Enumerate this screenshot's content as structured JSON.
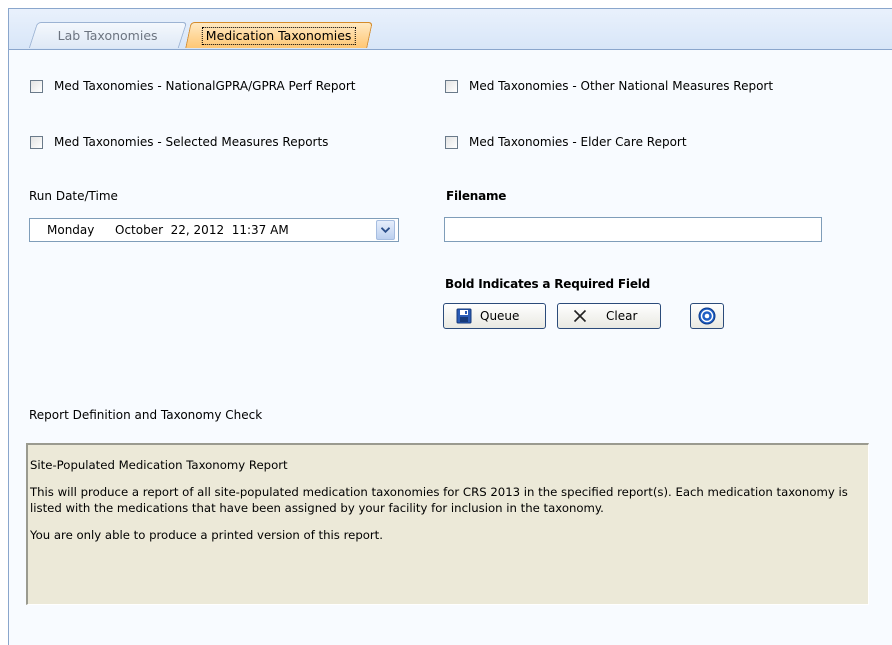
{
  "tabs": [
    {
      "label": "Lab Taxonomies",
      "active": false
    },
    {
      "label": "Medication Taxonomies",
      "active": true
    }
  ],
  "checkboxes": [
    {
      "label": "Med Taxonomies - NationalGPRA/GPRA Perf Report",
      "checked": false
    },
    {
      "label": "Med Taxonomies - Other National Measures Report",
      "checked": false
    },
    {
      "label": "Med Taxonomies - Selected Measures Reports",
      "checked": false
    },
    {
      "label": "Med Taxonomies - Elder Care Report",
      "checked": false
    }
  ],
  "run_date": {
    "label": "Run Date/Time",
    "day": "Monday",
    "datetime": "October  22, 2012  11:37 AM"
  },
  "filename": {
    "label": "Filename",
    "value": "",
    "placeholder": ""
  },
  "required_note": "Bold Indicates a Required Field",
  "buttons": {
    "queue": "Queue",
    "clear": "Clear"
  },
  "section_title": "Report Definition and Taxonomy Check",
  "description": {
    "heading": "Site-Populated Medication Taxonomy Report",
    "body": "This will produce a report of all site-populated medication taxonomies for CRS 2013 in the specified report(s).  Each medication taxonomy is listed with the medications that have been assigned by your facility for inclusion in the taxonomy.",
    "note": "You are only able to produce a printed version of this report."
  },
  "colors": {
    "active_tab": "#ffc774",
    "tab_strip": "#d8e6f8",
    "info_background": "#ece9d8",
    "help_icon": "#1f5fc6"
  },
  "icons": {
    "queue": "floppy-disk-icon",
    "clear": "x-icon",
    "help": "help-icon",
    "dropdown": "chevron-down-icon"
  }
}
